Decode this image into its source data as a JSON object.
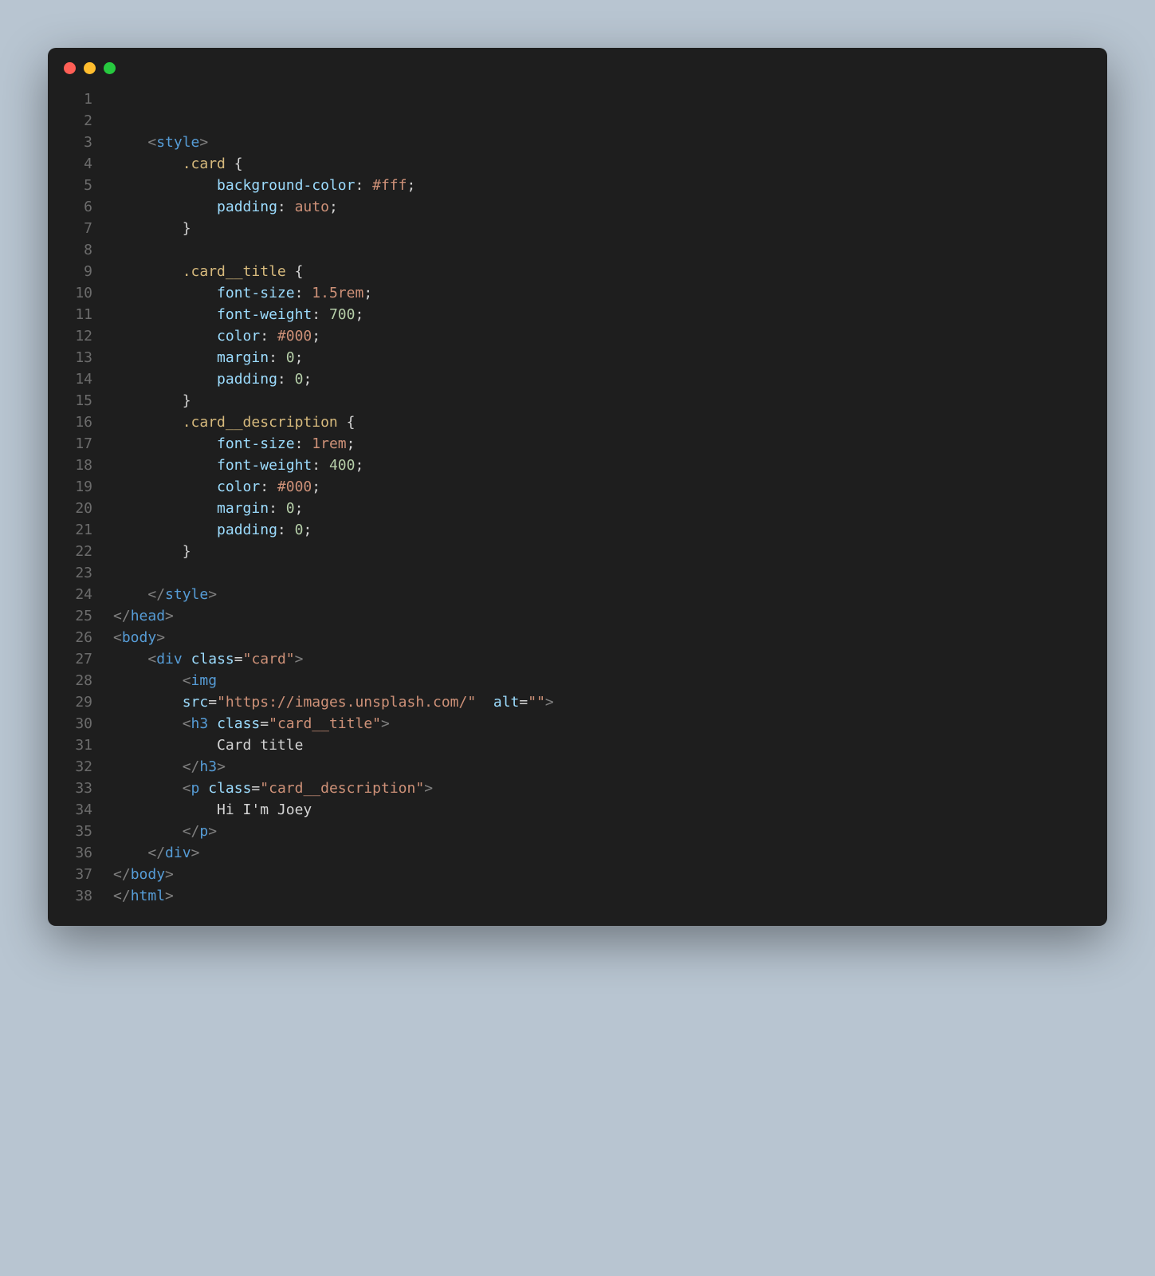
{
  "lines": {
    "l1": "1",
    "l2": "2",
    "l3": "3",
    "l4": "4",
    "l5": "5",
    "l6": "6",
    "l7": "7",
    "l8": "8",
    "l9": "9",
    "l10": "10",
    "l11": "11",
    "l12": "12",
    "l13": "13",
    "l14": "14",
    "l15": "15",
    "l16": "16",
    "l17": "17",
    "l18": "18",
    "l19": "19",
    "l20": "20",
    "l21": "21",
    "l22": "22",
    "l23": "23",
    "l24": "24",
    "l25": "25",
    "l26": "26",
    "l27": "27",
    "l28": "28",
    "l29": "29",
    "l30": "30",
    "l31": "31",
    "l32": "32",
    "l33": "33",
    "l34": "34",
    "l35": "35",
    "l36": "36",
    "l37": "37",
    "l38": "38"
  },
  "tokens": {
    "lt": "<",
    "gt": ">",
    "ltslash": "</",
    "style": "style",
    "head": "head",
    "body": "body",
    "html": "html",
    "div": "div",
    "img": "img",
    "h3": "h3",
    "p": "p",
    "sel_card": ".card",
    "sel_card_title": ".card__title",
    "sel_card_description": ".card__description",
    "open_brace": " {",
    "close_brace": "}",
    "prop_bgcolor": "background-color",
    "prop_padding": "padding",
    "prop_fontsize": "font-size",
    "prop_fontweight": "font-weight",
    "prop_color": "color",
    "prop_margin": "margin",
    "val_fff": "#fff",
    "val_auto": "auto",
    "val_15rem": "1.5rem",
    "val_1rem": "1rem",
    "val_700": "700",
    "val_400": "400",
    "val_000": "#000",
    "val_0": "0",
    "colon": ": ",
    "semicolon": ";",
    "attr_class": "class",
    "attr_src": "src",
    "attr_alt": "alt",
    "eq": "=",
    "q": "\"",
    "val_card": "card",
    "val_card_title": "card__title",
    "val_card_description": "card__description",
    "val_src": "https://images.unsplash.com/",
    "val_alt": "",
    "txt_cardtitle": "Card title",
    "txt_joey": "Hi I'm Joey"
  }
}
